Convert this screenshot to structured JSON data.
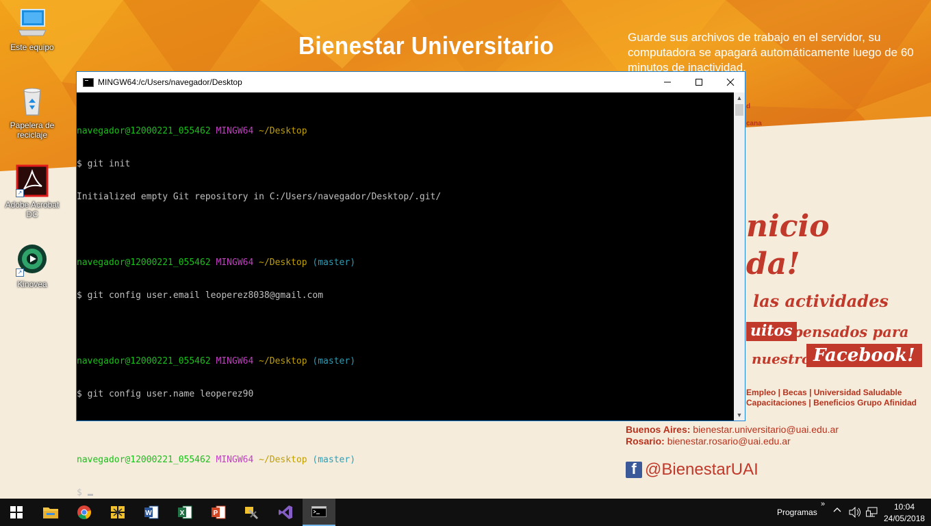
{
  "wallpaper": {
    "title": "Bienestar Universitario",
    "notice": "Guarde sus archivos de trabajo en el servidor, su computadora se apagará automáticamente luego de 60 minutos de inactividad.",
    "fragment_1": "d",
    "fragment_2": "cana",
    "script_1": "nicio",
    "script_2": "da!",
    "script_3": "las actividades",
    "script_4_box": "uitos",
    "script_4": "pensados para",
    "script_5": "nuestro",
    "script_5_box": "Facebook!",
    "links_line1": "Empleo | Becas | Universidad Saludable",
    "links_line2": "Capacitaciones | Beneficios Grupo Afinidad",
    "contact_ba_label": "Buenos Aires:",
    "contact_ba_value": "bienestar.universitario@uai.edu.ar",
    "contact_ros_label": "Rosario:",
    "contact_ros_value": "bienestar.rosario@uai.edu.ar",
    "facebook_handle": "@BienestarUAI"
  },
  "desktop_icons": [
    {
      "label": "Este equipo",
      "icon": "computer-icon"
    },
    {
      "label": "Papelera de reciclaje",
      "icon": "recycle-bin-icon"
    },
    {
      "label": "Adobe Acrobat DC",
      "icon": "acrobat-icon"
    },
    {
      "label": "Kinovea",
      "icon": "kinovea-icon"
    }
  ],
  "terminal": {
    "title": "MINGW64:/c/Users/navegador/Desktop",
    "prompt_user": "navegador@12000221_055462",
    "prompt_env": "MINGW64",
    "prompt_path": "~/Desktop",
    "prompt_branch": "(master)",
    "lines": {
      "cmd1": "$ git init",
      "out1": "Initialized empty Git repository in C:/Users/navegador/Desktop/.git/",
      "cmd2": "$ git config user.email leoperez8038@gmail.com",
      "cmd3": "$ git config user.name leoperez90",
      "cmd4": "$ "
    }
  },
  "taskbar": {
    "apps": [
      "start-button",
      "file-explorer-icon",
      "chrome-icon",
      "app-icon",
      "word-icon",
      "excel-icon",
      "powerpoint-icon",
      "tools-icon",
      "visual-studio-icon",
      "terminal-icon"
    ],
    "toolbar_label": "Programas",
    "toolbar_chevron": "»",
    "time": "10:04",
    "date": "24/05/2018"
  }
}
